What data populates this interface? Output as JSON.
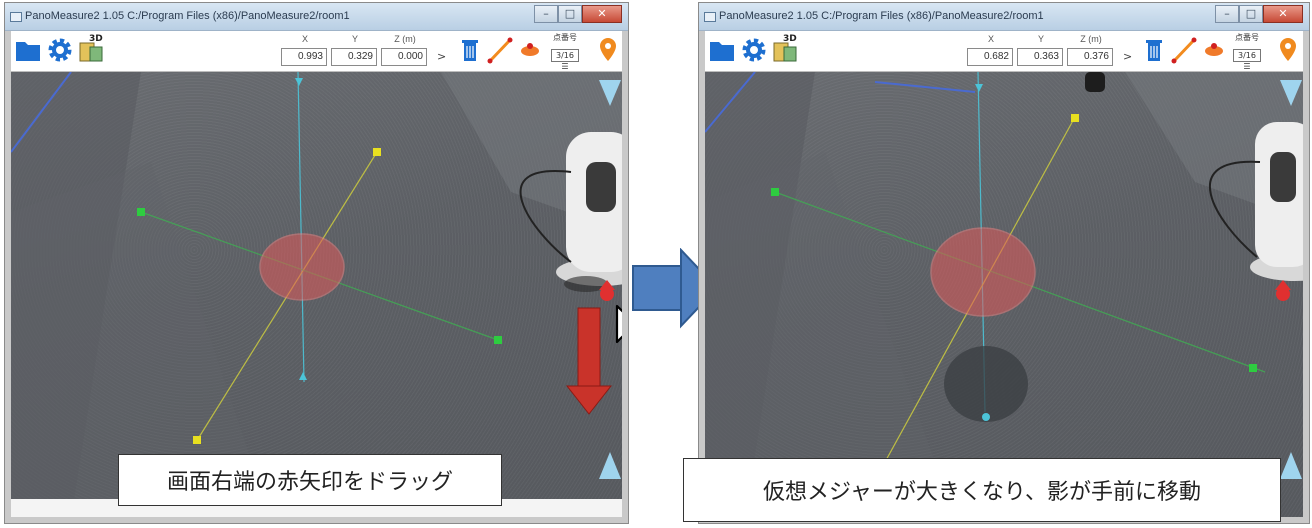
{
  "left_window": {
    "title": "PanoMeasure2 1.05  C:/Program Files (x86)/PanoMeasure2/room1",
    "coords": {
      "x_label": "X",
      "y_label": "Y",
      "z_label": "Z (m)",
      "x": "0.993",
      "y": "0.329",
      "z": "0.000"
    },
    "points_label": "点番号",
    "points_value": "3/16 ☰",
    "caption": "画面右端の赤矢印をドラッグ"
  },
  "right_window": {
    "title": "PanoMeasure2 1.05  C:/Program Files (x86)/PanoMeasure2/room1",
    "coords": {
      "x_label": "X",
      "y_label": "Y",
      "z_label": "Z (m)",
      "x": "0.682",
      "y": "0.363",
      "z": "0.376"
    },
    "points_label": "点番号",
    "points_value": "3/16 ☰",
    "caption": "仮想メジャーが大きくなり、影が手前に移動"
  },
  "toolbar": {
    "more_symbol": ">",
    "icons": [
      "folder-icon",
      "gear-icon",
      "3d-view-icon",
      "trash-icon",
      "measure-line-icon",
      "shape-icon",
      "map-pin-icon"
    ],
    "3d_label": "3D"
  },
  "window_buttons": {
    "minimize": "–",
    "maximize": "□",
    "close": "✕"
  },
  "colors": {
    "accent_blue": "#1e6fd0",
    "marker_red": "#e03030",
    "drag_arrow_red": "#c9332a",
    "transition_arrow_blue": "#4f7fbf",
    "point_green": "#2ecc40",
    "point_yellow": "#e8e020"
  }
}
